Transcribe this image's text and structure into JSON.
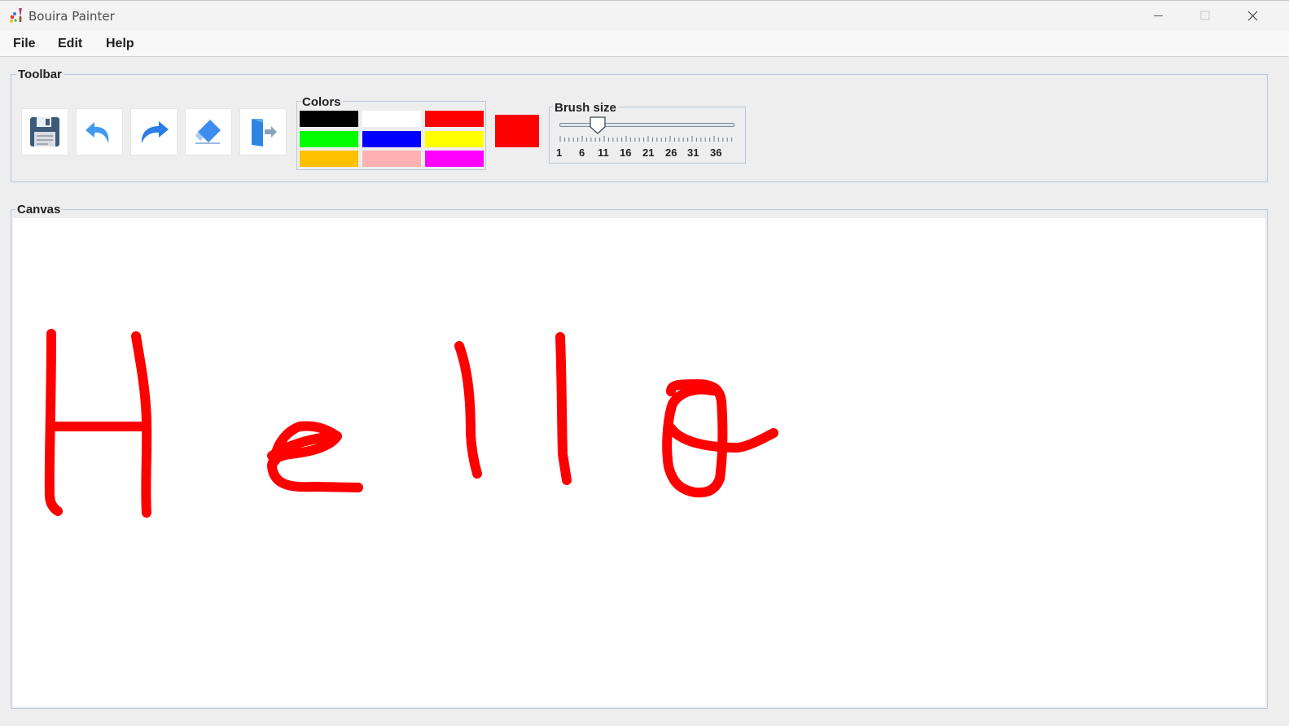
{
  "window": {
    "title": "Bouira Painter",
    "controls": [
      "minimize",
      "maximize",
      "close"
    ]
  },
  "menu": {
    "items": [
      {
        "label": "File"
      },
      {
        "label": "Edit"
      },
      {
        "label": "Help"
      }
    ]
  },
  "toolbar": {
    "title": "Toolbar",
    "buttons": [
      {
        "icon": "save-icon"
      },
      {
        "icon": "undo-icon"
      },
      {
        "icon": "redo-icon"
      },
      {
        "icon": "eraser-icon"
      },
      {
        "icon": "exit-icon"
      }
    ]
  },
  "colors": {
    "title": "Colors",
    "swatches": [
      "#000000",
      "#ffffff",
      "#ff0000",
      "#00ff00",
      "#0000ff",
      "#ffff00",
      "#ffc000",
      "#ffb0b0",
      "#ff00ff"
    ],
    "current": "#ff0000"
  },
  "brush": {
    "title": "Brush size",
    "value": 10,
    "min": 1,
    "max": 40,
    "tick_labels": [
      "1",
      "6",
      "11",
      "16",
      "21",
      "26",
      "31",
      "36"
    ]
  },
  "canvas": {
    "title": "Canvas",
    "stroke_color": "#ff0000"
  }
}
